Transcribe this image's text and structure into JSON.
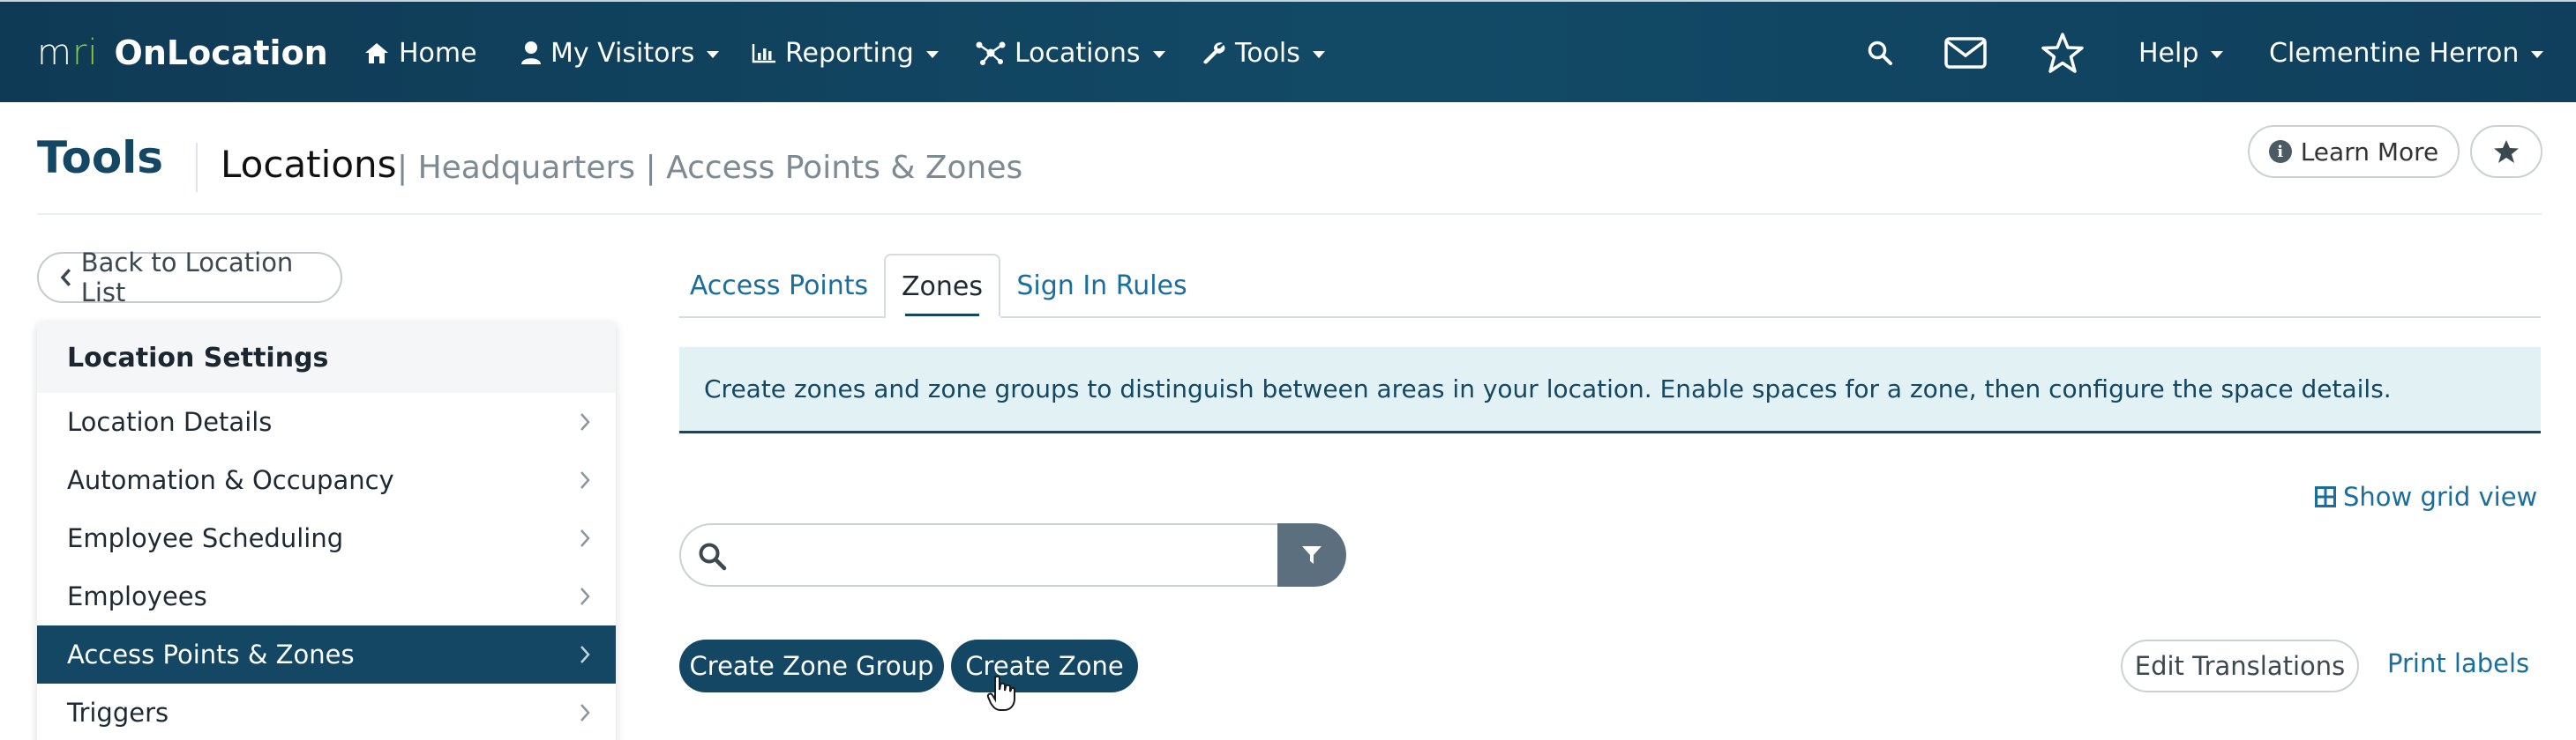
{
  "brand": {
    "logo": "mri",
    "app_name": "OnLocation"
  },
  "nav": {
    "items": [
      {
        "label": "Home",
        "icon": "home-icon",
        "caret": false
      },
      {
        "label": "My Visitors",
        "icon": "user-icon",
        "caret": true
      },
      {
        "label": "Reporting",
        "icon": "bar-chart-icon",
        "caret": true
      },
      {
        "label": "Locations",
        "icon": "network-icon",
        "caret": true
      },
      {
        "label": "Tools",
        "icon": "wrench-icon",
        "caret": true
      }
    ],
    "right": {
      "search_icon": "search-icon",
      "mail_icon": "envelope-icon",
      "star_icon": "star-icon",
      "help_label": "Help",
      "user_name": "Clementine Herron"
    }
  },
  "header": {
    "title": "Tools",
    "breadcrumb_main": "Locations",
    "breadcrumb_rest": "| Headquarters | Access Points & Zones",
    "learn_more": "Learn More"
  },
  "sidebar": {
    "back_label": "Back to Location List",
    "section_title": "Location Settings",
    "items": [
      {
        "label": "Location Details",
        "active": false
      },
      {
        "label": "Automation & Occupancy",
        "active": false
      },
      {
        "label": "Employee Scheduling",
        "active": false
      },
      {
        "label": "Employees",
        "active": false
      },
      {
        "label": "Access Points & Zones",
        "active": true
      },
      {
        "label": "Triggers",
        "active": false
      }
    ]
  },
  "tabs": [
    {
      "label": "Access Points",
      "active": false
    },
    {
      "label": "Zones",
      "active": true
    },
    {
      "label": "Sign In Rules",
      "active": false
    }
  ],
  "banner": {
    "text": "Create zones and zone groups to distinguish between areas in your location. Enable spaces for a zone, then configure the space details."
  },
  "grid_view_label": "Show grid view",
  "search": {
    "value": "",
    "placeholder": ""
  },
  "actions": {
    "create_zone_group": "Create Zone Group",
    "create_zone": "Create Zone",
    "edit_translations": "Edit Translations",
    "print_labels": "Print labels"
  },
  "colors": {
    "nav_bg": "#124a66",
    "primary": "#134763",
    "link": "#1a6e9e",
    "banner_bg": "#e2f2f4",
    "brand_green": "#8cc63f"
  }
}
